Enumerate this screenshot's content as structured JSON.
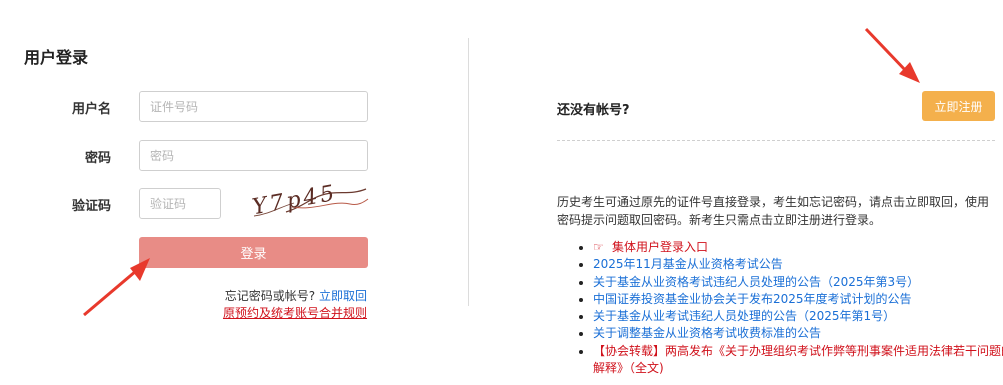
{
  "login": {
    "title": "用户登录",
    "username_label": "用户名",
    "username_placeholder": "证件号码",
    "password_label": "密码",
    "password_placeholder": "密码",
    "captcha_label": "验证码",
    "captcha_placeholder": "验证码",
    "captcha_text": "Y7p45",
    "submit_label": "登录",
    "forgot_text": "忘记密码或帐号?",
    "forgot_link": "立即取回",
    "merge_rule_link": "原预约及统考账号合并规则"
  },
  "register": {
    "no_account_text": "还没有帐号?",
    "register_button": "立即注册",
    "description": "历史考生可通过原先的证件号直接登录，考生如忘记密码，请点击立即取回，使用密码提示问题取回密码。新考生只需点击立即注册进行登录。"
  },
  "notices": [
    {
      "icon": "pointing-hand-icon",
      "text": "集体用户登录入口",
      "color": "#d0111b"
    },
    {
      "text": "2025年11月基金从业资格考试公告",
      "color": "#1a6fd6"
    },
    {
      "text": "关于基金从业资格考试违纪人员处理的公告（2025年第3号）",
      "color": "#1a6fd6"
    },
    {
      "text": "中国证券投资基金业协会关于发布2025年度考试计划的公告",
      "color": "#1a6fd6"
    },
    {
      "text": "关于基金从业考试违纪人员处理的公告（2025年第1号）",
      "color": "#1a6fd6"
    },
    {
      "text": "关于调整基金从业资格考试收费标准的公告",
      "color": "#1a6fd6"
    },
    {
      "text": "【协会转载】两高发布《关于办理组织考试作弊等刑事案件适用法律若干问题的解释》（全文)",
      "color": "#d0111b"
    }
  ],
  "colors": {
    "link_blue": "#1a6fd6",
    "alert_red": "#d0111b",
    "login_button": "#e88c86",
    "register_button": "#f4b04c",
    "annotation_arrow": "#e8392c"
  }
}
